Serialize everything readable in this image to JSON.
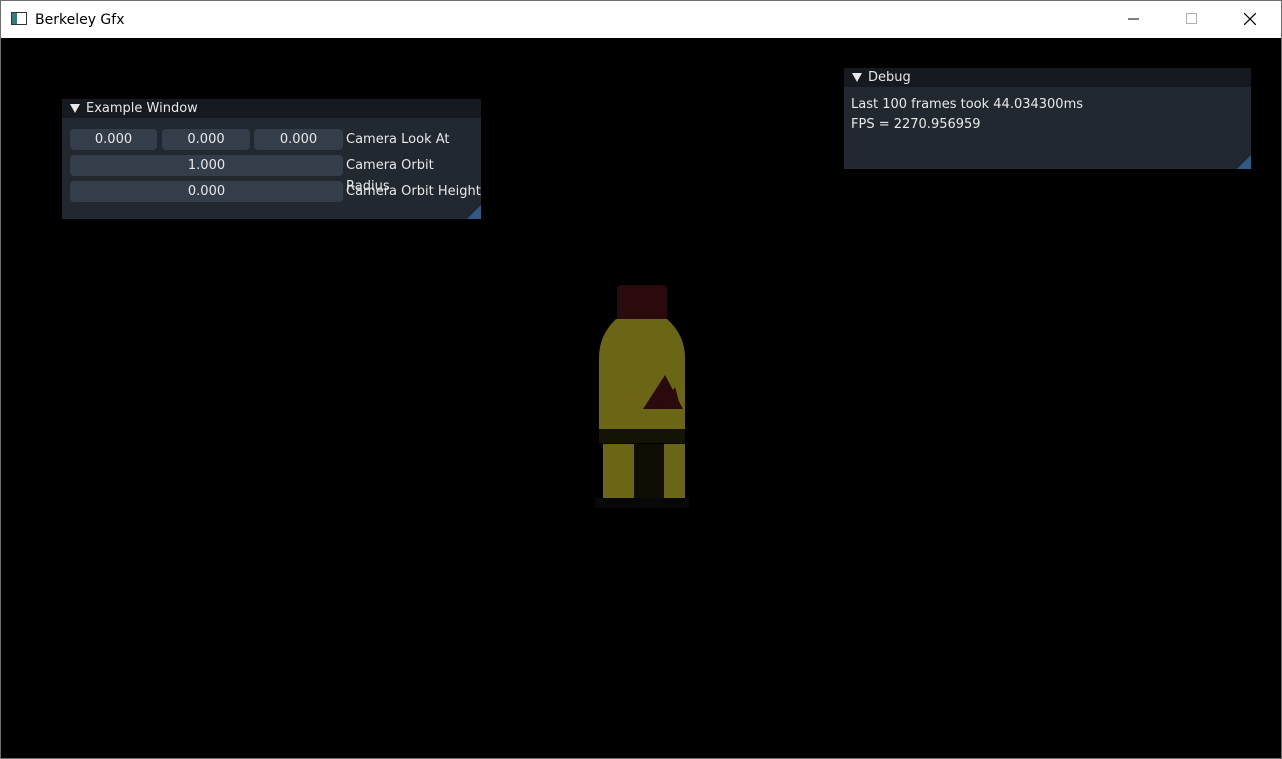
{
  "window": {
    "title": "Berkeley Gfx"
  },
  "icons": {
    "app": "app-window-icon",
    "minimize": "minimize-icon",
    "maximize": "maximize-icon",
    "close": "close-icon",
    "collapse": "collapse-arrow-icon",
    "resize": "resize-grip-icon"
  },
  "example_window": {
    "title": "Example Window",
    "rows": [
      {
        "label": "Camera Look At",
        "values": [
          "0.000",
          "0.000",
          "0.000"
        ]
      },
      {
        "label": "Camera Orbit Radius",
        "values": [
          "1.000"
        ]
      },
      {
        "label": "Camera Orbit Height",
        "values": [
          "0.000"
        ]
      }
    ]
  },
  "debug_window": {
    "title": "Debug",
    "lines": [
      "Last 100 frames took 44.034300ms",
      "FPS = 2270.956959"
    ]
  },
  "colors": {
    "panel_bg": "#222a31",
    "panel_title_bg": "#141a1f",
    "field_bg": "#333e4a",
    "grip": "#2d5a86",
    "bottle_body": "#6b6616",
    "bottle_cap": "#2a0a0c"
  }
}
